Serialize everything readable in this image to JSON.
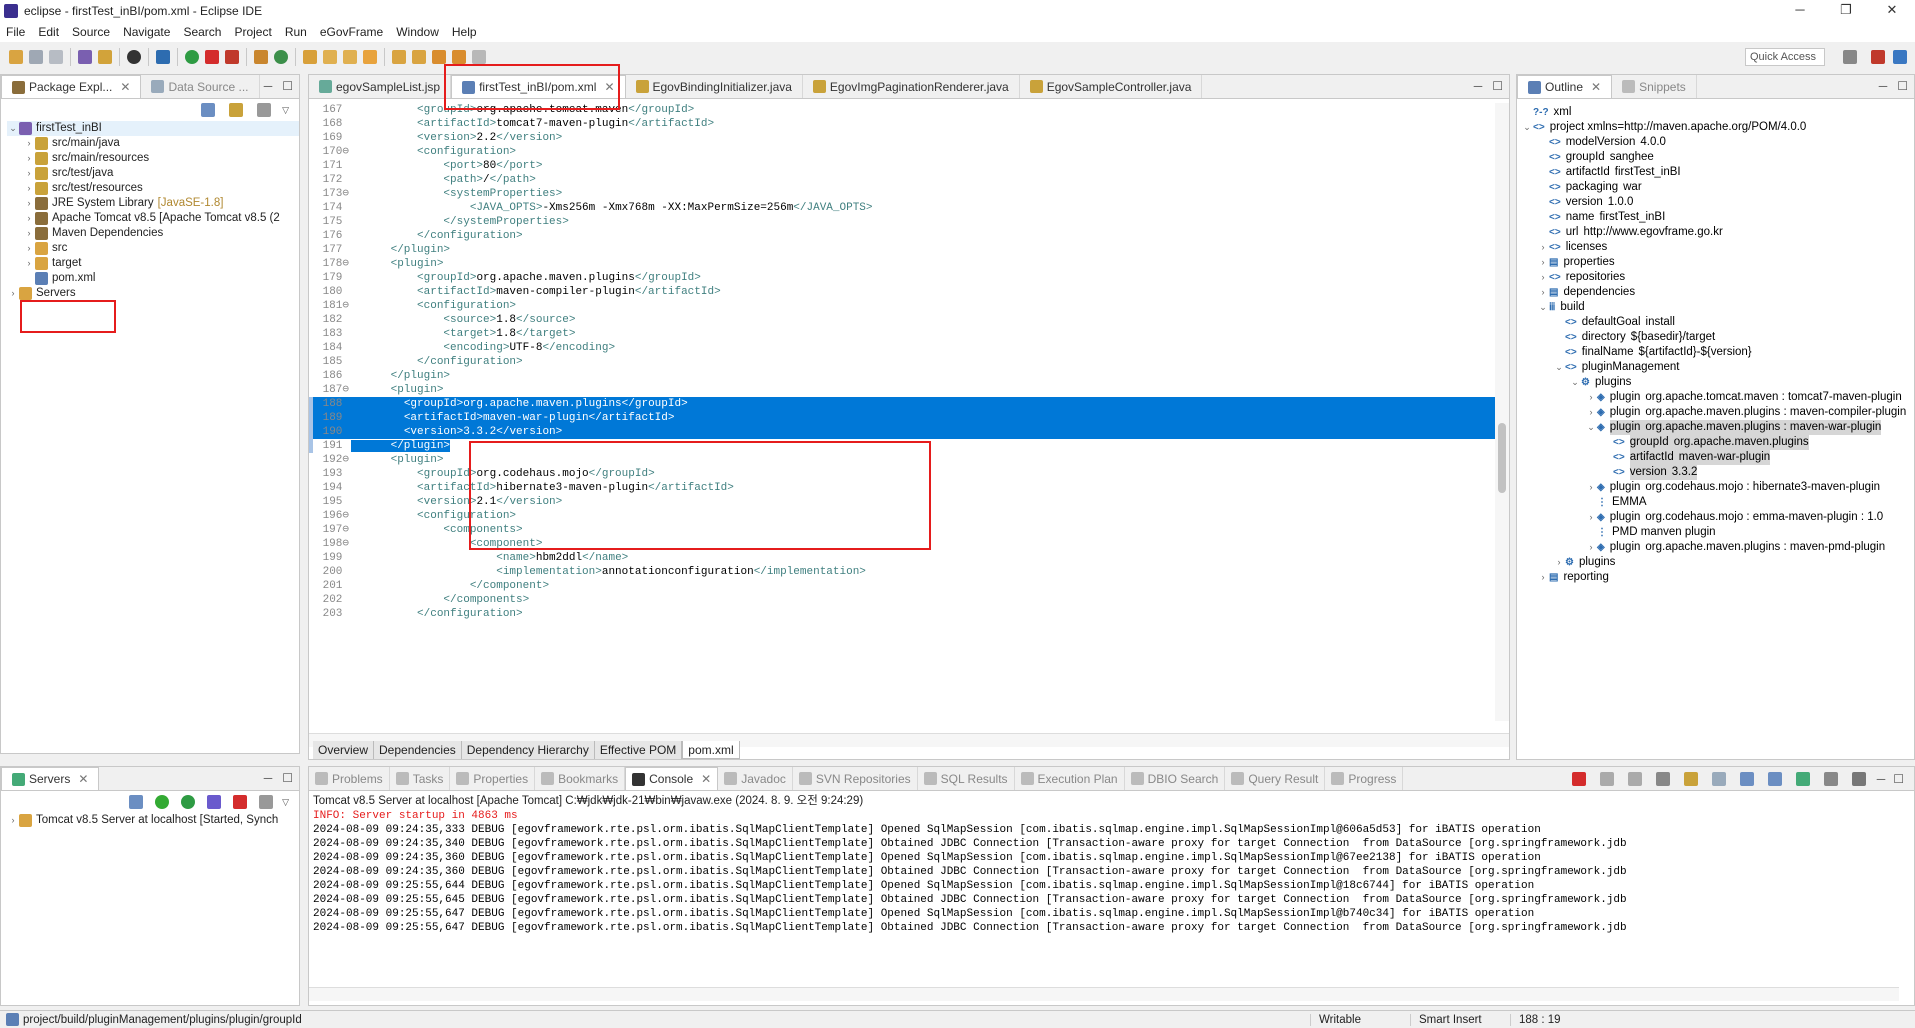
{
  "window": {
    "title": "eclipse - firstTest_inBI/pom.xml - Eclipse IDE",
    "minimize": "─",
    "maximize": "❐",
    "close": "✕"
  },
  "menu": [
    "File",
    "Edit",
    "Source",
    "Navigate",
    "Search",
    "Project",
    "Run",
    "eGovFrame",
    "Window",
    "Help"
  ],
  "quick_access": "Quick Access",
  "left_tabs": {
    "package_explorer": "Package Expl...",
    "data_source": "Data Source ..."
  },
  "project_tree": [
    {
      "label": "firstTest_inBI",
      "level": 0,
      "expanded": true,
      "icon": "project-icon"
    },
    {
      "label": "src/main/java",
      "level": 1,
      "icon": "source-folder-icon"
    },
    {
      "label": "src/main/resources",
      "level": 1,
      "icon": "source-folder-icon"
    },
    {
      "label": "src/test/java",
      "level": 1,
      "icon": "source-folder-icon"
    },
    {
      "label": "src/test/resources",
      "level": 1,
      "icon": "source-folder-icon"
    },
    {
      "label": "JRE System Library",
      "extra": "[JavaSE-1.8]",
      "level": 1,
      "icon": "library-icon"
    },
    {
      "label": "Apache Tomcat v8.5 [Apache Tomcat v8.5 (2",
      "level": 1,
      "icon": "library-icon"
    },
    {
      "label": "Maven Dependencies",
      "level": 1,
      "icon": "library-icon"
    },
    {
      "label": "src",
      "level": 1,
      "icon": "folder-icon"
    },
    {
      "label": "target",
      "level": 1,
      "icon": "folder-icon"
    },
    {
      "label": "pom.xml",
      "level": 1,
      "icon": "xml-file-icon"
    },
    {
      "label": "Servers",
      "level": 0,
      "icon": "folder-icon"
    }
  ],
  "editor_tabs": [
    {
      "label": "egovSampleList.jsp"
    },
    {
      "label": "firstTest_inBI/pom.xml",
      "active": true
    },
    {
      "label": "EgovBindingInitializer.java"
    },
    {
      "label": "EgovImgPaginationRenderer.java"
    },
    {
      "label": "EgovSampleController.java"
    }
  ],
  "code_lines": [
    {
      "n": "167",
      "indent": 10,
      "parts": [
        [
          "t",
          "<groupId>"
        ],
        [
          "x",
          "org.apache.tomcat.maven"
        ],
        [
          "t",
          "</groupId>"
        ]
      ]
    },
    {
      "n": "168",
      "indent": 10,
      "parts": [
        [
          "t",
          "<artifactId>"
        ],
        [
          "x",
          "tomcat7-maven-plugin"
        ],
        [
          "t",
          "</artifactId>"
        ]
      ]
    },
    {
      "n": "169",
      "indent": 10,
      "parts": [
        [
          "t",
          "<version>"
        ],
        [
          "x",
          "2.2"
        ],
        [
          "t",
          "</version>"
        ]
      ]
    },
    {
      "n": "170",
      "indent": 10,
      "fold": true,
      "parts": [
        [
          "t",
          "<configuration>"
        ]
      ]
    },
    {
      "n": "171",
      "indent": 14,
      "parts": [
        [
          "t",
          "<port>"
        ],
        [
          "x",
          "80"
        ],
        [
          "t",
          "</port>"
        ]
      ]
    },
    {
      "n": "172",
      "indent": 14,
      "parts": [
        [
          "t",
          "<path>"
        ],
        [
          "x",
          "/"
        ],
        [
          "t",
          "</path>"
        ]
      ]
    },
    {
      "n": "173",
      "indent": 14,
      "fold": true,
      "parts": [
        [
          "t",
          "<systemProperties>"
        ]
      ]
    },
    {
      "n": "174",
      "indent": 18,
      "parts": [
        [
          "t",
          "<JAVA_OPTS>"
        ],
        [
          "x",
          "-Xms256m -Xmx768m -XX:MaxPermSize=256m"
        ],
        [
          "t",
          "</JAVA_OPTS>"
        ]
      ]
    },
    {
      "n": "175",
      "indent": 14,
      "parts": [
        [
          "t",
          "</systemProperties>"
        ]
      ]
    },
    {
      "n": "176",
      "indent": 10,
      "parts": [
        [
          "t",
          "</configuration>"
        ]
      ]
    },
    {
      "n": "177",
      "indent": 6,
      "parts": [
        [
          "t",
          "</plugin>"
        ]
      ]
    },
    {
      "n": "178",
      "indent": 6,
      "fold": true,
      "parts": [
        [
          "t",
          "<plugin>"
        ]
      ]
    },
    {
      "n": "179",
      "indent": 10,
      "parts": [
        [
          "t",
          "<groupId>"
        ],
        [
          "x",
          "org.apache.maven.plugins"
        ],
        [
          "t",
          "</groupId>"
        ]
      ]
    },
    {
      "n": "180",
      "indent": 10,
      "parts": [
        [
          "t",
          "<artifactId>"
        ],
        [
          "x",
          "maven-compiler-plugin"
        ],
        [
          "t",
          "</artifactId>"
        ]
      ]
    },
    {
      "n": "181",
      "indent": 10,
      "fold": true,
      "parts": [
        [
          "t",
          "<configuration>"
        ]
      ]
    },
    {
      "n": "182",
      "indent": 14,
      "parts": [
        [
          "t",
          "<source>"
        ],
        [
          "x",
          "1.8"
        ],
        [
          "t",
          "</source>"
        ]
      ]
    },
    {
      "n": "183",
      "indent": 14,
      "parts": [
        [
          "t",
          "<target>"
        ],
        [
          "x",
          "1.8"
        ],
        [
          "t",
          "</target>"
        ]
      ]
    },
    {
      "n": "184",
      "indent": 14,
      "parts": [
        [
          "t",
          "<encoding>"
        ],
        [
          "x",
          "UTF-8"
        ],
        [
          "t",
          "</encoding>"
        ]
      ]
    },
    {
      "n": "185",
      "indent": 10,
      "parts": [
        [
          "t",
          "</configuration>"
        ]
      ]
    },
    {
      "n": "186",
      "indent": 6,
      "parts": [
        [
          "t",
          "</plugin>"
        ]
      ]
    },
    {
      "n": "187",
      "indent": 6,
      "fold": true,
      "parts": [
        [
          "t",
          "<plugin>"
        ]
      ]
    },
    {
      "n": "188",
      "indent": 8,
      "sel": true,
      "parts": [
        [
          "t",
          "<groupId>"
        ],
        [
          "x",
          "org.apache.maven.plugins"
        ],
        [
          "t",
          "</groupId>"
        ]
      ]
    },
    {
      "n": "189",
      "indent": 8,
      "sel": true,
      "parts": [
        [
          "t",
          "<artifactId>"
        ],
        [
          "x",
          "maven-war-plugin"
        ],
        [
          "t",
          "</artifactId>"
        ]
      ]
    },
    {
      "n": "190",
      "indent": 8,
      "sel": true,
      "parts": [
        [
          "t",
          "<version>"
        ],
        [
          "x",
          "3.3.2"
        ],
        [
          "t",
          "</version>"
        ]
      ]
    },
    {
      "n": "191",
      "indent": 6,
      "sel": true,
      "partial": true,
      "parts": [
        [
          "t",
          "</plugin>"
        ]
      ]
    },
    {
      "n": "192",
      "indent": 6,
      "fold": true,
      "parts": [
        [
          "t",
          "<plugin>"
        ]
      ]
    },
    {
      "n": "193",
      "indent": 10,
      "parts": [
        [
          "t",
          "<groupId>"
        ],
        [
          "x",
          "org.codehaus.mojo"
        ],
        [
          "t",
          "</groupId>"
        ]
      ]
    },
    {
      "n": "194",
      "indent": 10,
      "parts": [
        [
          "t",
          "<artifactId>"
        ],
        [
          "x",
          "hibernate3-maven-plugin"
        ],
        [
          "t",
          "</artifactId>"
        ]
      ]
    },
    {
      "n": "195",
      "indent": 10,
      "parts": [
        [
          "t",
          "<version>"
        ],
        [
          "x",
          "2.1"
        ],
        [
          "t",
          "</version>"
        ]
      ]
    },
    {
      "n": "196",
      "indent": 10,
      "fold": true,
      "parts": [
        [
          "t",
          "<configuration>"
        ]
      ]
    },
    {
      "n": "197",
      "indent": 14,
      "fold": true,
      "parts": [
        [
          "t",
          "<components>"
        ]
      ]
    },
    {
      "n": "198",
      "indent": 18,
      "fold": true,
      "parts": [
        [
          "t",
          "<component>"
        ]
      ]
    },
    {
      "n": "199",
      "indent": 22,
      "parts": [
        [
          "t",
          "<name>"
        ],
        [
          "x",
          "hbm2ddl"
        ],
        [
          "t",
          "</name>"
        ]
      ]
    },
    {
      "n": "200",
      "indent": 22,
      "parts": [
        [
          "t",
          "<implementation>"
        ],
        [
          "x",
          "annotationconfiguration"
        ],
        [
          "t",
          "</implementation>"
        ]
      ]
    },
    {
      "n": "201",
      "indent": 18,
      "parts": [
        [
          "t",
          "</component>"
        ]
      ]
    },
    {
      "n": "202",
      "indent": 14,
      "parts": [
        [
          "t",
          "</components>"
        ]
      ]
    },
    {
      "n": "203",
      "indent": 10,
      "parts": [
        [
          "t",
          "</configuration>"
        ]
      ]
    }
  ],
  "pom_tabs": [
    "Overview",
    "Dependencies",
    "Dependency Hierarchy",
    "Effective POM",
    "pom.xml"
  ],
  "outline": {
    "tabs": {
      "outline": "Outline",
      "snippets": "Snippets"
    },
    "items": [
      {
        "level": 0,
        "tag": "?-?",
        "label": "xml"
      },
      {
        "level": 0,
        "tw": "v",
        "tag": "<>",
        "label": "project xmlns=http://maven.apache.org/POM/4.0.0"
      },
      {
        "level": 1,
        "tag": "<>",
        "label": "modelVersion",
        "val": "4.0.0"
      },
      {
        "level": 1,
        "tag": "<>",
        "label": "groupId",
        "val": "sanghee"
      },
      {
        "level": 1,
        "tag": "<>",
        "label": "artifactId",
        "val": "firstTest_inBI"
      },
      {
        "level": 1,
        "tag": "<>",
        "label": "packaging",
        "val": "war"
      },
      {
        "level": 1,
        "tag": "<>",
        "label": "version",
        "val": "1.0.0"
      },
      {
        "level": 1,
        "tag": "<>",
        "label": "name",
        "val": "firstTest_inBI"
      },
      {
        "level": 1,
        "tag": "<>",
        "label": "url",
        "val": "http://www.egovframe.go.kr"
      },
      {
        "level": 1,
        "tw": ">",
        "tag": "<>",
        "label": "licenses"
      },
      {
        "level": 1,
        "tw": ">",
        "tag": "▤",
        "label": "properties"
      },
      {
        "level": 1,
        "tw": ">",
        "tag": "<>",
        "label": "repositories"
      },
      {
        "level": 1,
        "tw": ">",
        "tag": "▤",
        "label": "dependencies"
      },
      {
        "level": 1,
        "tw": "v",
        "tag": "ⅲ",
        "label": "build"
      },
      {
        "level": 2,
        "tag": "<>",
        "label": "defaultGoal",
        "val": "install"
      },
      {
        "level": 2,
        "tag": "<>",
        "label": "directory",
        "val": "${basedir}/target"
      },
      {
        "level": 2,
        "tag": "<>",
        "label": "finalName",
        "val": "${artifactId}-${version}"
      },
      {
        "level": 2,
        "tw": "v",
        "tag": "<>",
        "label": "pluginManagement"
      },
      {
        "level": 3,
        "tw": "v",
        "tag": "⚙",
        "label": "plugins"
      },
      {
        "level": 4,
        "tw": ">",
        "tag": "◈",
        "label": "plugin",
        "val": "org.apache.tomcat.maven : tomcat7-maven-plugin"
      },
      {
        "level": 4,
        "tw": ">",
        "tag": "◈",
        "label": "plugin",
        "val": "org.apache.maven.plugins : maven-compiler-plugin"
      },
      {
        "level": 4,
        "tw": "v",
        "tag": "◈",
        "label": "plugin",
        "val": "org.apache.maven.plugins : maven-war-plugin",
        "hl": true
      },
      {
        "level": 5,
        "tag": "<>",
        "label": "groupId",
        "val": "org.apache.maven.plugins",
        "hl": true
      },
      {
        "level": 5,
        "tag": "<>",
        "label": "artifactId",
        "val": "maven-war-plugin",
        "hl": true
      },
      {
        "level": 5,
        "tag": "<>",
        "label": "version",
        "val": "3.3.2",
        "hl": true
      },
      {
        "level": 4,
        "tw": ">",
        "tag": "◈",
        "label": "plugin",
        "val": "org.codehaus.mojo : hibernate3-maven-plugin"
      },
      {
        "level": 4,
        "tag": "⋮",
        "label": "EMMA"
      },
      {
        "level": 4,
        "tw": ">",
        "tag": "◈",
        "label": "plugin",
        "val": "org.codehaus.mojo : emma-maven-plugin : 1.0"
      },
      {
        "level": 4,
        "tag": "⋮",
        "label": "PMD manven plugin"
      },
      {
        "level": 4,
        "tw": ">",
        "tag": "◈",
        "label": "plugin",
        "val": "org.apache.maven.plugins : maven-pmd-plugin"
      },
      {
        "level": 2,
        "tw": ">",
        "tag": "⚙",
        "label": "plugins"
      },
      {
        "level": 1,
        "tw": ">",
        "tag": "▤",
        "label": "reporting"
      }
    ]
  },
  "servers": {
    "tab": "Servers",
    "item": "Tomcat v8.5 Server at localhost  [Started, Synch"
  },
  "bottom_tabs": [
    {
      "label": "Problems"
    },
    {
      "label": "Tasks"
    },
    {
      "label": "Properties"
    },
    {
      "label": "Bookmarks"
    },
    {
      "label": "Console",
      "active": true
    },
    {
      "label": "Javadoc"
    },
    {
      "label": "SVN Repositories"
    },
    {
      "label": "SQL Results"
    },
    {
      "label": "Execution Plan"
    },
    {
      "label": "DBIO Search"
    },
    {
      "label": "Query Result"
    },
    {
      "label": "Progress"
    }
  ],
  "console": {
    "header": "Tomcat v8.5 Server at localhost [Apache Tomcat] C:₩jdk₩jdk-21₩bin₩javaw.exe  (2024. 8. 9. 오전 9:24:29)",
    "info": "INFO: Server startup in 4863 ms",
    "lines": [
      "2024-08-09 09:24:35,333 DEBUG [egovframework.rte.psl.orm.ibatis.SqlMapClientTemplate] Opened SqlMapSession [com.ibatis.sqlmap.engine.impl.SqlMapSessionImpl@606a5d53] for iBATIS operation",
      "2024-08-09 09:24:35,340 DEBUG [egovframework.rte.psl.orm.ibatis.SqlMapClientTemplate] Obtained JDBC Connection [Transaction-aware proxy for target Connection  from DataSource [org.springframework.jdb",
      "2024-08-09 09:24:35,360 DEBUG [egovframework.rte.psl.orm.ibatis.SqlMapClientTemplate] Opened SqlMapSession [com.ibatis.sqlmap.engine.impl.SqlMapSessionImpl@67ee2138] for iBATIS operation",
      "2024-08-09 09:24:35,360 DEBUG [egovframework.rte.psl.orm.ibatis.SqlMapClientTemplate] Obtained JDBC Connection [Transaction-aware proxy for target Connection  from DataSource [org.springframework.jdb",
      "2024-08-09 09:25:55,644 DEBUG [egovframework.rte.psl.orm.ibatis.SqlMapClientTemplate] Opened SqlMapSession [com.ibatis.sqlmap.engine.impl.SqlMapSessionImpl@18c6744] for iBATIS operation",
      "2024-08-09 09:25:55,645 DEBUG [egovframework.rte.psl.orm.ibatis.SqlMapClientTemplate] Obtained JDBC Connection [Transaction-aware proxy for target Connection  from DataSource [org.springframework.jdb",
      "2024-08-09 09:25:55,647 DEBUG [egovframework.rte.psl.orm.ibatis.SqlMapClientTemplate] Opened SqlMapSession [com.ibatis.sqlmap.engine.impl.SqlMapSessionImpl@b740c34] for iBATIS operation",
      "2024-08-09 09:25:55,647 DEBUG [egovframework.rte.psl.orm.ibatis.SqlMapClientTemplate] Obtained JDBC Connection [Transaction-aware proxy for target Connection  from DataSource [org.springframework.jdb"
    ]
  },
  "status": {
    "path": "project/build/pluginManagement/plugins/plugin/groupId",
    "mode": "Writable",
    "insert": "Smart Insert",
    "pos": "188 : 19"
  },
  "colors": {
    "selection": "#0078d7",
    "annotation": "#e51c1c",
    "tag": "#3f7f7f",
    "console_info": "#e51c1c"
  }
}
